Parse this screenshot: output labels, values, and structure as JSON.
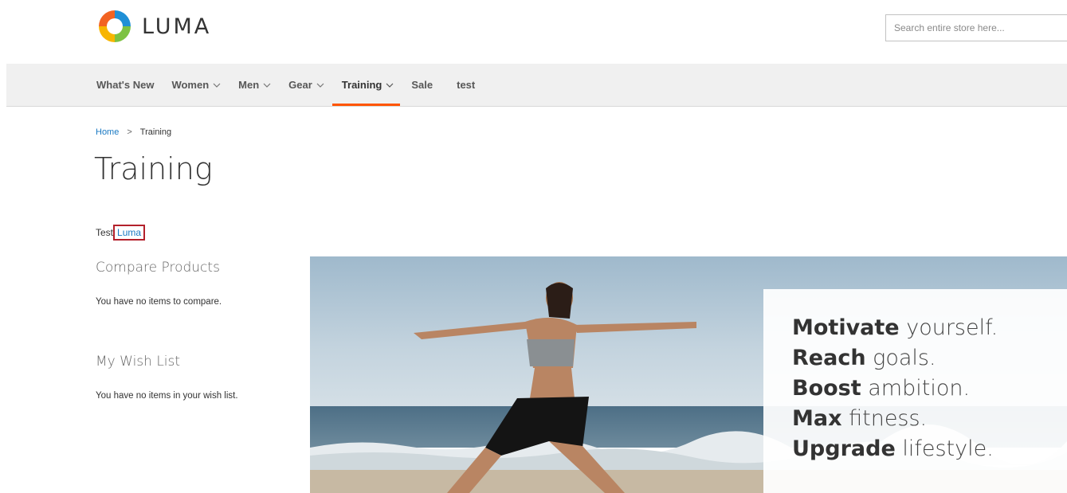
{
  "brand": {
    "name": "LUMA"
  },
  "search": {
    "placeholder": "Search entire store here..."
  },
  "nav": {
    "items": [
      {
        "label": "What's New",
        "dropdown": false
      },
      {
        "label": "Women",
        "dropdown": true
      },
      {
        "label": "Men",
        "dropdown": true
      },
      {
        "label": "Gear",
        "dropdown": true
      },
      {
        "label": "Training",
        "dropdown": true,
        "active": true
      },
      {
        "label": "Sale",
        "dropdown": false
      },
      {
        "label": "test",
        "dropdown": false
      }
    ]
  },
  "breadcrumb": {
    "home": "Home",
    "separator": ">",
    "current": "Training"
  },
  "page": {
    "title": "Training"
  },
  "description": {
    "prefix": "Test",
    "link": "Luma"
  },
  "sidebar": {
    "compare": {
      "title": "Compare Products",
      "empty": "You have no items to compare."
    },
    "wishlist": {
      "title": "My Wish List",
      "empty": "You have no items in your wish list."
    }
  },
  "banner": {
    "lines": [
      {
        "bold": "Motivate",
        "rest": "yourself."
      },
      {
        "bold": "Reach",
        "rest": "goals."
      },
      {
        "bold": "Boost",
        "rest": "ambition."
      },
      {
        "bold": "Max",
        "rest": "fitness."
      },
      {
        "bold": "Upgrade",
        "rest": "lifestyle."
      }
    ]
  },
  "colors": {
    "accent": "#ff5501",
    "link": "#1979c3",
    "highlight_box": "#b3202b",
    "nav_bg": "#f0f0f0"
  }
}
